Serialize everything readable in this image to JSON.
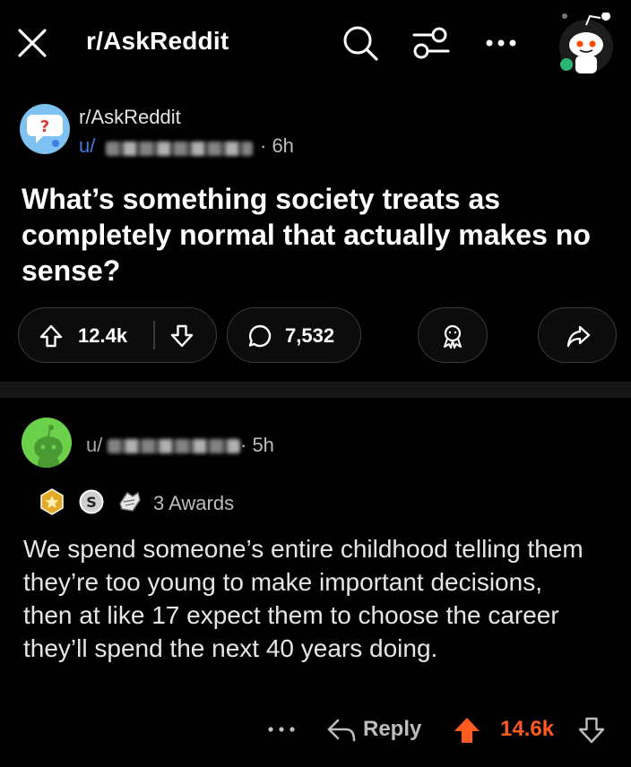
{
  "topbar": {
    "title": "r/AskReddit",
    "icons": [
      "close-icon",
      "search-icon",
      "filter-icon",
      "more-icon",
      "avatar-snoo-icon"
    ]
  },
  "post": {
    "subreddit": "r/AskReddit",
    "user_prefix": "u/",
    "time": "· 6h",
    "title": "What’s something society treats as completely normal that actually makes no sense?",
    "votes": "12.4k",
    "comments": "7,532"
  },
  "comment": {
    "user_prefix": "u/",
    "time": "· 5h",
    "awards_label": "3 Awards",
    "body": "We spend someone’s entire childhood telling them they’re too young to make important decisions, then at like 17 expect them to choose the career they’ll spend the next 40 years doing.",
    "reply_label": "Reply",
    "score": "14.6k"
  },
  "colors": {
    "background": "#000000",
    "username_blue": "#3f7be3",
    "upvote_orange": "#ff5a1f",
    "subreddit_avatar": "#7fc2f2",
    "comment_avatar": "#6bd14a"
  }
}
